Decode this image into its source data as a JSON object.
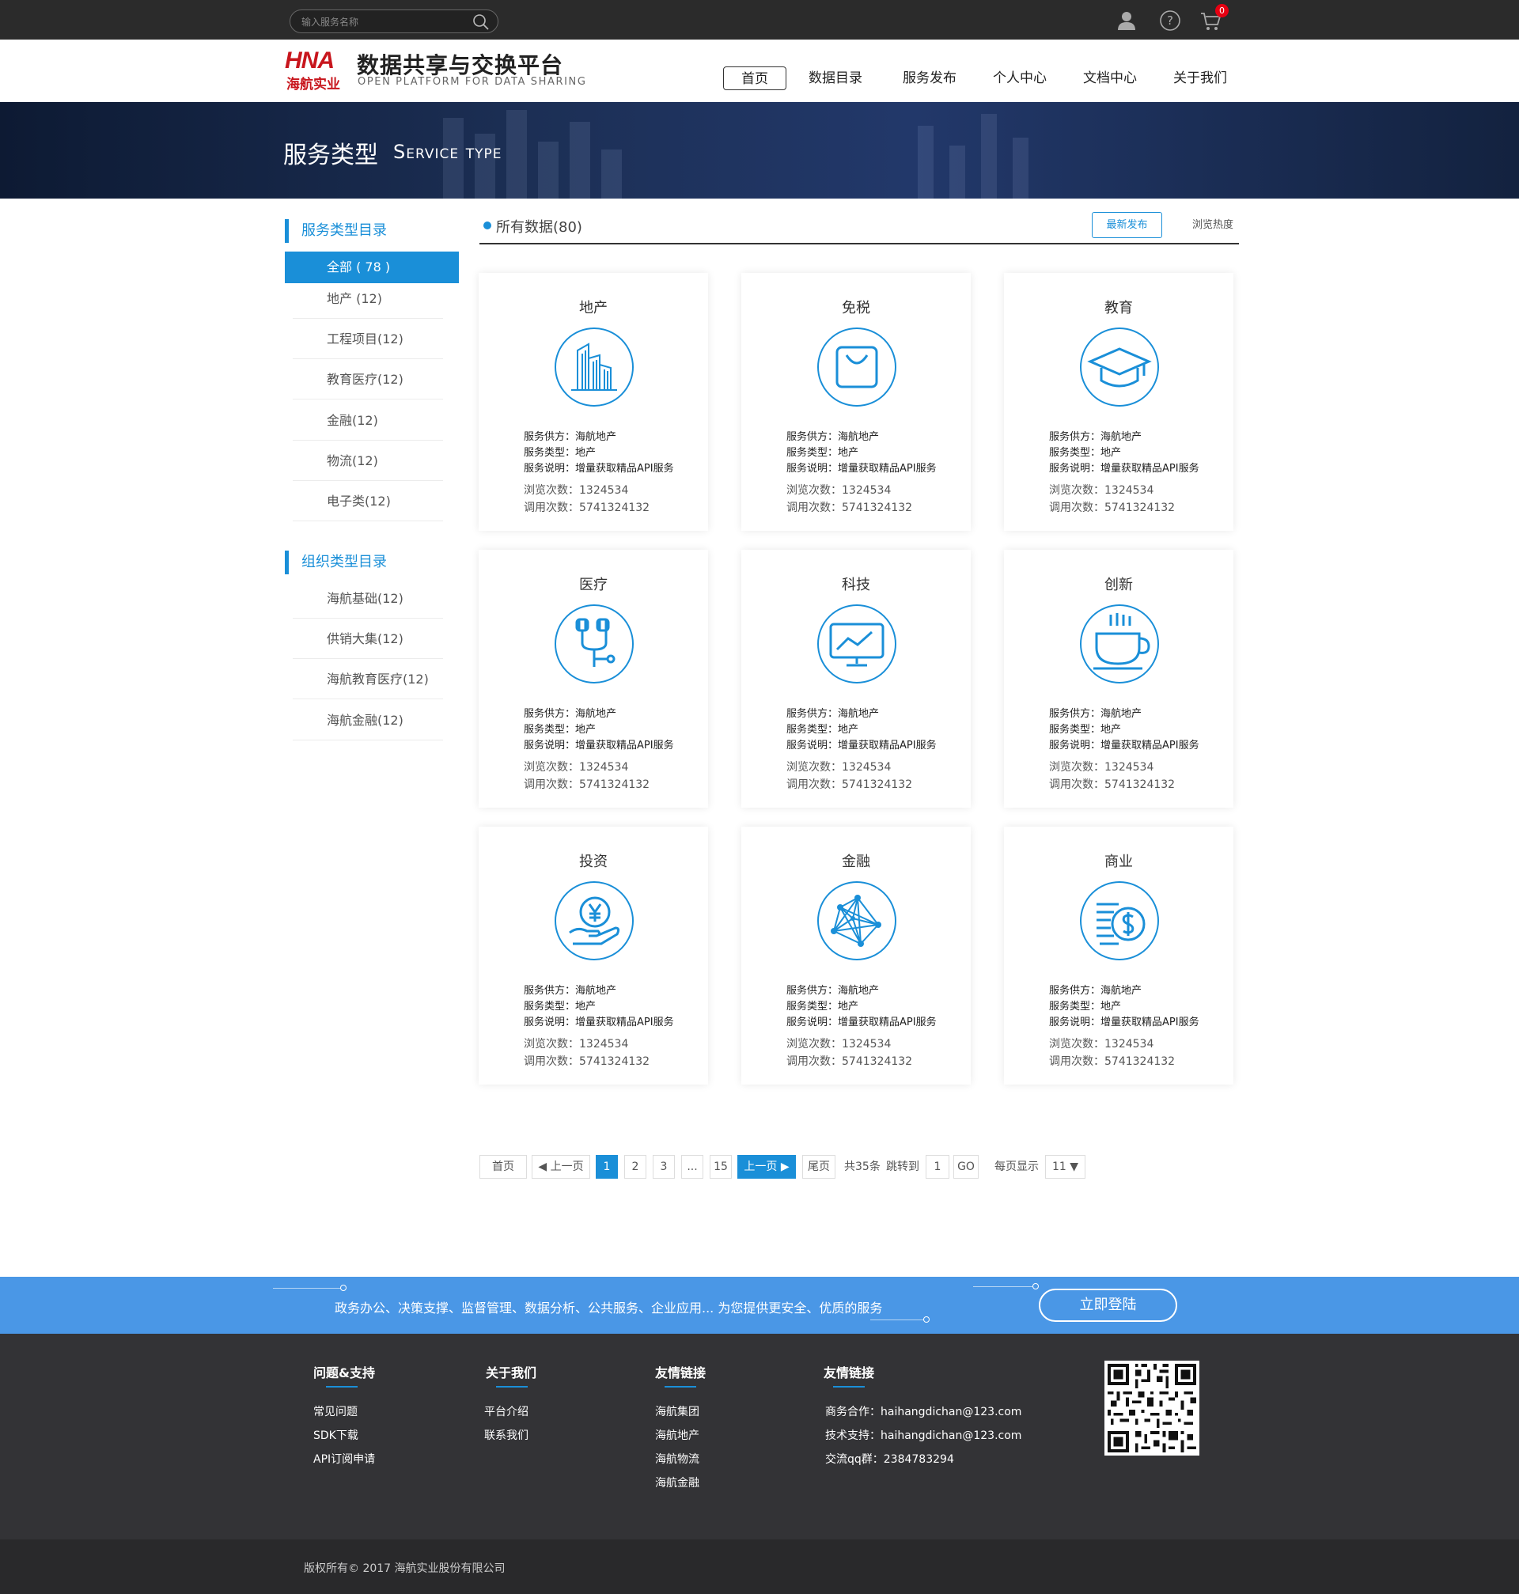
{
  "topbar": {
    "search_placeholder": "输入服务名称",
    "cart_count": "0"
  },
  "header": {
    "logo_en": "HNA",
    "logo_cn": "海航实业",
    "title": "数据共享与交换平台",
    "subtitle": "OPEN PLATFORM FOR DATA SHARING",
    "nav": [
      "首页",
      "数据目录",
      "服务发布",
      "个人中心",
      "文档中心",
      "关于我们"
    ]
  },
  "banner": {
    "title_cn": "服务类型",
    "title_en": "Service type"
  },
  "sidebar": {
    "service_heading": "服务类型目录",
    "service_items": [
      "全部 ( 78 )",
      "地产 (12)",
      "工程项目(12)",
      "教育医疗(12)",
      "金融(12)",
      "物流(12)",
      "电子类(12)"
    ],
    "org_heading": "组织类型目录",
    "org_items": [
      "海航基础(12)",
      "供销大集(12)",
      "海航教育医疗(12)",
      "海航金融(12)"
    ]
  },
  "main": {
    "title": "所有数据(80)",
    "sort_new": "最新发布",
    "sort_hot": "浏览热度"
  },
  "cards": [
    {
      "title": "地产",
      "icon": "buildings-icon",
      "provider": "服务供方：海航地产",
      "type": "服务类型：地产",
      "desc": "服务说明：增量获取精品API服务",
      "views": "浏览次数：1324534",
      "calls": "调用次数：5741324132"
    },
    {
      "title": "免税",
      "icon": "shopping-bag-icon",
      "provider": "服务供方：海航地产",
      "type": "服务类型：地产",
      "desc": "服务说明：增量获取精品API服务",
      "views": "浏览次数：1324534",
      "calls": "调用次数：5741324132"
    },
    {
      "title": "教育",
      "icon": "graduation-cap-icon",
      "provider": "服务供方：海航地产",
      "type": "服务类型：地产",
      "desc": "服务说明：增量获取精品API服务",
      "views": "浏览次数：1324534",
      "calls": "调用次数：5741324132"
    },
    {
      "title": "医疗",
      "icon": "stethoscope-icon",
      "provider": "服务供方：海航地产",
      "type": "服务类型：地产",
      "desc": "服务说明：增量获取精品API服务",
      "views": "浏览次数：1324534",
      "calls": "调用次数：5741324132"
    },
    {
      "title": "科技",
      "icon": "monitor-chart-icon",
      "provider": "服务供方：海航地产",
      "type": "服务类型：地产",
      "desc": "服务说明：增量获取精品API服务",
      "views": "浏览次数：1324534",
      "calls": "调用次数：5741324132"
    },
    {
      "title": "创新",
      "icon": "coffee-cup-icon",
      "provider": "服务供方：海航地产",
      "type": "服务类型：地产",
      "desc": "服务说明：增量获取精品API服务",
      "views": "浏览次数：1324534",
      "calls": "调用次数：5741324132"
    },
    {
      "title": "投资",
      "icon": "yen-hand-icon",
      "provider": "服务供方：海航地产",
      "type": "服务类型：地产",
      "desc": "服务说明：增量获取精品API服务",
      "views": "浏览次数：1324534",
      "calls": "调用次数：5741324132"
    },
    {
      "title": "金融",
      "icon": "network-icon",
      "provider": "服务供方：海航地产",
      "type": "服务类型：地产",
      "desc": "服务说明：增量获取精品API服务",
      "views": "浏览次数：1324534",
      "calls": "调用次数：5741324132"
    },
    {
      "title": "商业",
      "icon": "dollar-coin-icon",
      "provider": "服务供方：海航地产",
      "type": "服务类型：地产",
      "desc": "服务说明：增量获取精品API服务",
      "views": "浏览次数：1324534",
      "calls": "调用次数：5741324132"
    }
  ],
  "pagination": {
    "first": "首页",
    "prev": "◀ 上一页",
    "pages": [
      "1",
      "2",
      "3",
      "...",
      "15"
    ],
    "current": "1",
    "next": "上一页 ▶",
    "last": "尾页",
    "total": "共35条",
    "jump_label": "跳转到",
    "jump_value": "1",
    "go": "GO",
    "per_page_label": "每页显示",
    "per_page_value": "11 ▼"
  },
  "cta": {
    "text": "政务办公、决策支撑、监督管理、数据分析、公共服务、企业应用... 为您提供更安全、优质的服务",
    "button": "立即登陆"
  },
  "footer": {
    "columns": [
      {
        "heading": "问题&支持",
        "links": [
          "常见问题",
          "SDK下载",
          "API订阅申请"
        ]
      },
      {
        "heading": "关于我们",
        "links": [
          "平台介绍",
          "联系我们"
        ]
      },
      {
        "heading": "友情链接",
        "links": [
          "海航集团",
          "海航地产",
          "海航物流",
          "海航金融"
        ]
      },
      {
        "heading": "友情链接",
        "links": [
          "商务合作：haihangdichan@123.com",
          "技术支持：haihangdichan@123.com",
          "交流qq群：2384783294"
        ]
      }
    ],
    "copyright": "版权所有© 2017 海航实业股份有限公司"
  },
  "colors": {
    "accent": "#1a8fd8",
    "cta_bg": "#4a97e6",
    "topbar_bg": "#2b2b2b",
    "footer_bg": "#333336",
    "brand_red": "#c8161d"
  }
}
